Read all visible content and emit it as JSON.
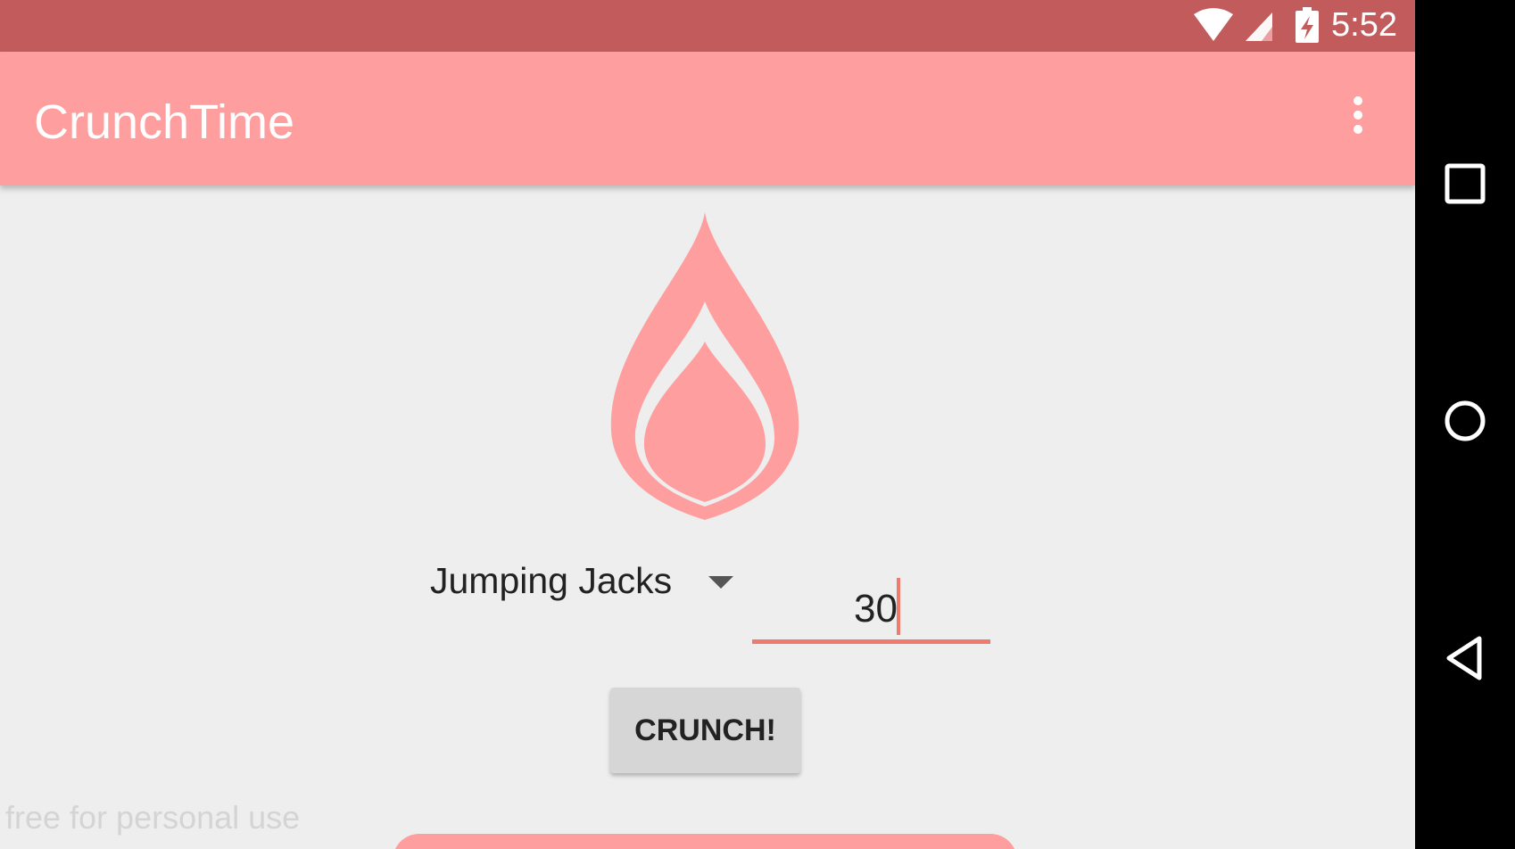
{
  "status_bar": {
    "time": "5:52",
    "icons": [
      "wifi-icon",
      "signal-icon",
      "battery-charging-icon"
    ]
  },
  "app_bar": {
    "title": "CrunchTime",
    "overflow_icon": "more-vert-icon"
  },
  "exercise_spinner": {
    "selected": "Jumping Jacks"
  },
  "reps_input": {
    "value": "30"
  },
  "crunch_button": {
    "label": "CRUNCH!"
  },
  "watermark": {
    "text": "free for personal use"
  },
  "nav_bar": {
    "buttons": [
      "recents-square-icon",
      "home-circle-icon",
      "back-triangle-icon"
    ]
  },
  "colors": {
    "status_bar": "#c25c5c",
    "app_bar": "#ff9e9e",
    "accent": "#f27a6c",
    "background": "#eeeeee"
  }
}
